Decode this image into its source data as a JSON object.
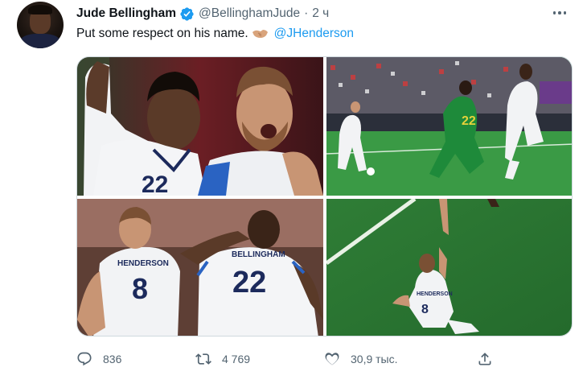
{
  "tweet": {
    "display_name": "Jude Bellingham",
    "verified_icon": "verified-badge-icon",
    "handle": "@BellinghamJude",
    "separator": "·",
    "time": "2 ч",
    "text": "Put some respect on his name.",
    "emoji": "handshake-emoji",
    "mention": "@JHenderson"
  },
  "media": {
    "photos": [
      {
        "jersey_number": "22",
        "content": "celebration-closeup"
      },
      {
        "jersey_number": "22",
        "content": "match-action"
      },
      {
        "jersey_numbers": [
          "8",
          "22"
        ],
        "names": [
          "HENDERSON",
          "BELLINGHAM"
        ],
        "content": "players-back-view"
      },
      {
        "jersey_number": "8",
        "name": "HENDERSON",
        "content": "overhead-view"
      }
    ]
  },
  "actions": {
    "reply": {
      "icon": "reply-icon",
      "count": "836"
    },
    "retweet": {
      "icon": "retweet-icon",
      "count": "4 769"
    },
    "like": {
      "icon": "heart-icon",
      "count": "30,9 тыс."
    },
    "share": {
      "icon": "share-icon",
      "count": ""
    }
  },
  "colors": {
    "link": "#1d9bf0",
    "secondary_text": "#536471",
    "primary_text": "#0f1419",
    "england_shirt": "#f5f6f8",
    "england_navy": "#1c2a5c",
    "pitch_green": "#2f8a3a"
  }
}
